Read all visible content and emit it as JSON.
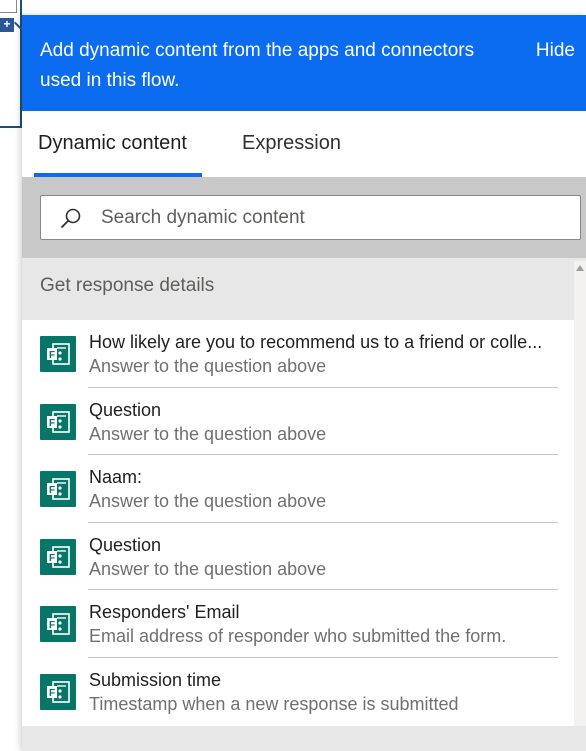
{
  "background": {
    "plus_glyph": "+"
  },
  "banner": {
    "text": "Add dynamic content from the apps and connectors used in this flow.",
    "hide_label": "Hide",
    "color": "#0b6cf0"
  },
  "tabs": [
    {
      "label": "Dynamic content",
      "selected": true
    },
    {
      "label": "Expression",
      "selected": false
    }
  ],
  "search": {
    "placeholder": "Search dynamic content",
    "value": "",
    "icon": "search-icon"
  },
  "section": {
    "title": "Get response details",
    "items": [
      {
        "title": "How likely are you to recommend us to a friend or colle...",
        "description": "Answer to the question above",
        "icon": "forms-icon"
      },
      {
        "title": "Question",
        "description": "Answer to the question above",
        "icon": "forms-icon"
      },
      {
        "title": "Naam:",
        "description": "Answer to the question above",
        "icon": "forms-icon"
      },
      {
        "title": "Question",
        "description": "Answer to the question above",
        "icon": "forms-icon"
      },
      {
        "title": "Responders' Email",
        "description": "Email address of responder who submitted the form.",
        "icon": "forms-icon"
      },
      {
        "title": "Submission time",
        "description": "Timestamp when a new response is submitted",
        "icon": "forms-icon"
      }
    ]
  },
  "colors": {
    "accent": "#0b6cf0",
    "forms_icon": "#077568",
    "section_bg": "#e6e7e6",
    "search_zone_bg": "#c8c8c8"
  }
}
